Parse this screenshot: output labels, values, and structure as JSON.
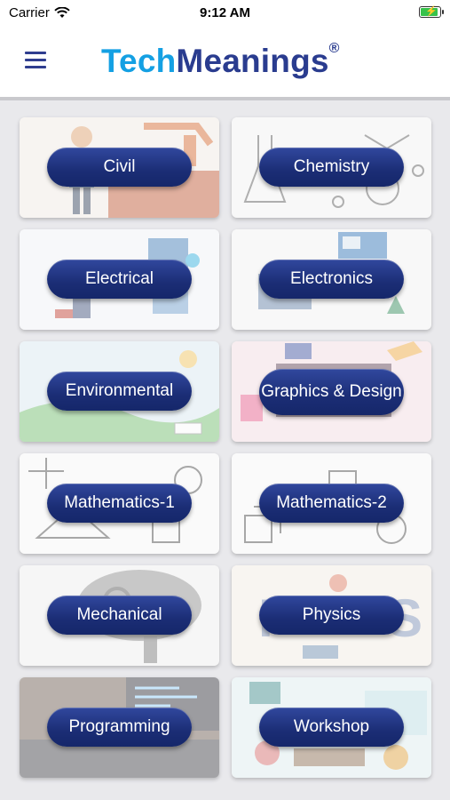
{
  "status_bar": {
    "carrier": "Carrier",
    "time": "9:12 AM"
  },
  "header": {
    "logo_part1": "Tech",
    "logo_part2": "Meanings",
    "logo_mark": "®",
    "menu_icon": "hamburger-menu-icon"
  },
  "categories": [
    {
      "label": "Civil"
    },
    {
      "label": "Chemistry"
    },
    {
      "label": "Electrical"
    },
    {
      "label": "Electronics"
    },
    {
      "label": "Environmental"
    },
    {
      "label": "Graphics & Design"
    },
    {
      "label": "Mathematics-1"
    },
    {
      "label": "Mathematics-2"
    },
    {
      "label": "Mechanical"
    },
    {
      "label": "Physics"
    },
    {
      "label": "Programming"
    },
    {
      "label": "Workshop"
    }
  ],
  "colors": {
    "accent_blue": "#14a0e3",
    "brand_navy": "#2a3c8f",
    "pill_navy": "#1b2d75",
    "background": "#e9e9ec"
  }
}
